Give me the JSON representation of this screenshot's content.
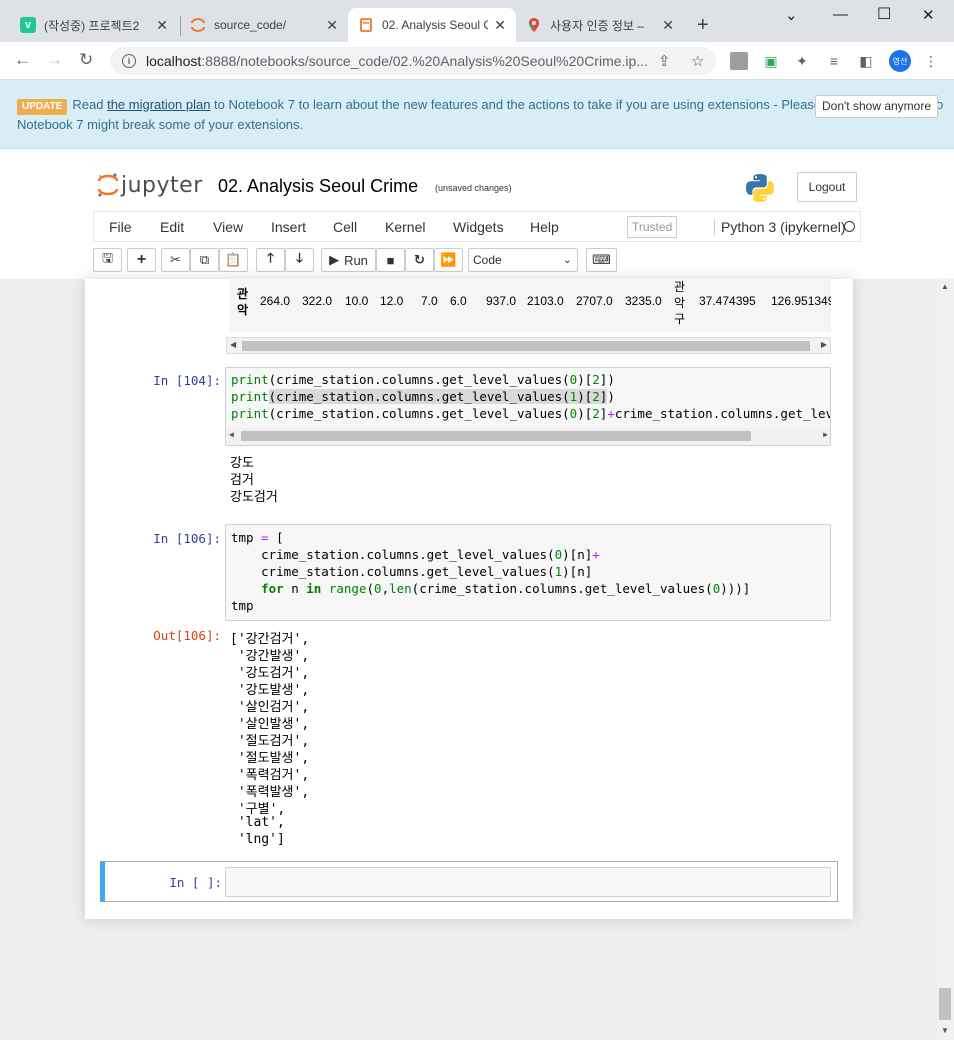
{
  "browser": {
    "tabs": [
      {
        "title": "(작성중) 프로젝트2",
        "favicon": "v-icon"
      },
      {
        "title": "source_code/",
        "favicon": "jupyter-icon"
      },
      {
        "title": "02. Analysis Seoul C",
        "favicon": "notebook-icon"
      },
      {
        "title": "사용자 인증 정보 –",
        "favicon": "maps-icon"
      }
    ],
    "active_tab_index": 2,
    "url_host": "localhost",
    "url_rest": ":8888/notebooks/source_code/02.%20Analysis%20Seoul%20Crime.ip...",
    "profile_label": "영선"
  },
  "banner": {
    "badge": "UPDATE",
    "text_before": "Read ",
    "link": "the migration plan",
    "text_after": " to Notebook 7 to learn about the new features and the actions to take if you are using extensions - Please note that updating to Notebook 7 might break some of your extensions.",
    "dismiss": "Don't show anymore"
  },
  "header": {
    "logo_text": "jupyter",
    "notebook_title": "02. Analysis Seoul Crime",
    "unsaved": "(unsaved changes)",
    "logout": "Logout"
  },
  "menu": {
    "items": [
      "File",
      "Edit",
      "View",
      "Insert",
      "Cell",
      "Kernel",
      "Widgets",
      "Help"
    ],
    "trusted": "Trusted",
    "kernel": "Python 3 (ipykernel)"
  },
  "toolbar": {
    "run_label": "Run",
    "cell_type": "Code"
  },
  "dataframe_row": {
    "index_label": "관\n악",
    "values": [
      "264.0",
      "322.0",
      "10.0",
      "12.0",
      "7.0",
      "6.0",
      "937.0",
      "2103.0",
      "2707.0",
      "3235.0"
    ],
    "gu_label": "관\n악\n구",
    "lat": "37.474395",
    "lng": "126.951349"
  },
  "cells": {
    "c104": {
      "prompt": "In [104]:",
      "output": [
        "강도",
        "검거",
        "강도검거"
      ]
    },
    "c106": {
      "prompt": "In [106]:",
      "out_prompt": "Out[106]:",
      "output": [
        "['강간검거',",
        " '강간발생',",
        " '강도검거',",
        " '강도발생',",
        " '살인검거',",
        " '살인발생',",
        " '절도검거',",
        " '절도발생',",
        " '폭력검거',",
        " '폭력발생',",
        " '구별',",
        " 'lat',",
        " 'lng']"
      ]
    },
    "empty": {
      "prompt": "In [ ]:"
    }
  }
}
